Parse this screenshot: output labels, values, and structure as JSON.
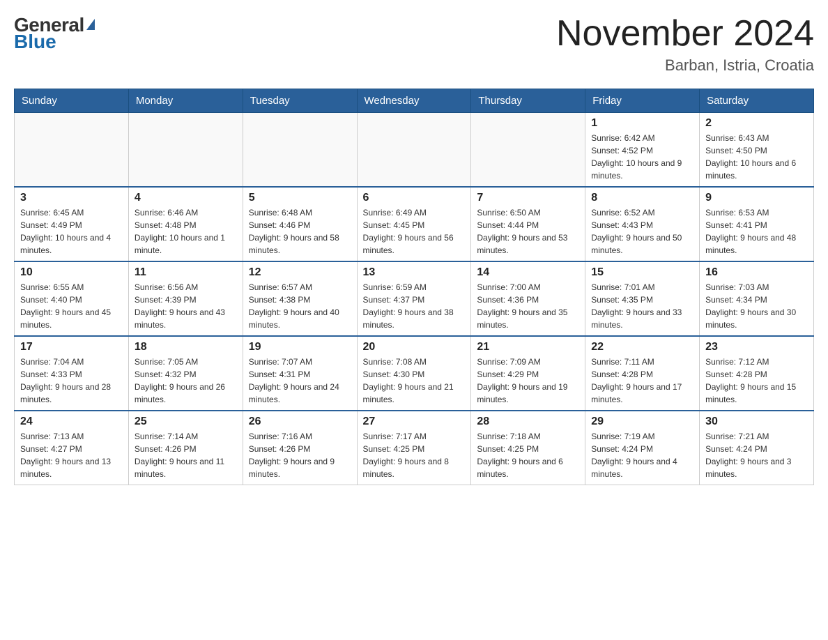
{
  "header": {
    "logo_general": "General",
    "logo_blue": "Blue",
    "month_title": "November 2024",
    "location": "Barban, Istria, Croatia"
  },
  "weekdays": [
    "Sunday",
    "Monday",
    "Tuesday",
    "Wednesday",
    "Thursday",
    "Friday",
    "Saturday"
  ],
  "weeks": [
    [
      {
        "day": "",
        "info": ""
      },
      {
        "day": "",
        "info": ""
      },
      {
        "day": "",
        "info": ""
      },
      {
        "day": "",
        "info": ""
      },
      {
        "day": "",
        "info": ""
      },
      {
        "day": "1",
        "info": "Sunrise: 6:42 AM\nSunset: 4:52 PM\nDaylight: 10 hours and 9 minutes."
      },
      {
        "day": "2",
        "info": "Sunrise: 6:43 AM\nSunset: 4:50 PM\nDaylight: 10 hours and 6 minutes."
      }
    ],
    [
      {
        "day": "3",
        "info": "Sunrise: 6:45 AM\nSunset: 4:49 PM\nDaylight: 10 hours and 4 minutes."
      },
      {
        "day": "4",
        "info": "Sunrise: 6:46 AM\nSunset: 4:48 PM\nDaylight: 10 hours and 1 minute."
      },
      {
        "day": "5",
        "info": "Sunrise: 6:48 AM\nSunset: 4:46 PM\nDaylight: 9 hours and 58 minutes."
      },
      {
        "day": "6",
        "info": "Sunrise: 6:49 AM\nSunset: 4:45 PM\nDaylight: 9 hours and 56 minutes."
      },
      {
        "day": "7",
        "info": "Sunrise: 6:50 AM\nSunset: 4:44 PM\nDaylight: 9 hours and 53 minutes."
      },
      {
        "day": "8",
        "info": "Sunrise: 6:52 AM\nSunset: 4:43 PM\nDaylight: 9 hours and 50 minutes."
      },
      {
        "day": "9",
        "info": "Sunrise: 6:53 AM\nSunset: 4:41 PM\nDaylight: 9 hours and 48 minutes."
      }
    ],
    [
      {
        "day": "10",
        "info": "Sunrise: 6:55 AM\nSunset: 4:40 PM\nDaylight: 9 hours and 45 minutes."
      },
      {
        "day": "11",
        "info": "Sunrise: 6:56 AM\nSunset: 4:39 PM\nDaylight: 9 hours and 43 minutes."
      },
      {
        "day": "12",
        "info": "Sunrise: 6:57 AM\nSunset: 4:38 PM\nDaylight: 9 hours and 40 minutes."
      },
      {
        "day": "13",
        "info": "Sunrise: 6:59 AM\nSunset: 4:37 PM\nDaylight: 9 hours and 38 minutes."
      },
      {
        "day": "14",
        "info": "Sunrise: 7:00 AM\nSunset: 4:36 PM\nDaylight: 9 hours and 35 minutes."
      },
      {
        "day": "15",
        "info": "Sunrise: 7:01 AM\nSunset: 4:35 PM\nDaylight: 9 hours and 33 minutes."
      },
      {
        "day": "16",
        "info": "Sunrise: 7:03 AM\nSunset: 4:34 PM\nDaylight: 9 hours and 30 minutes."
      }
    ],
    [
      {
        "day": "17",
        "info": "Sunrise: 7:04 AM\nSunset: 4:33 PM\nDaylight: 9 hours and 28 minutes."
      },
      {
        "day": "18",
        "info": "Sunrise: 7:05 AM\nSunset: 4:32 PM\nDaylight: 9 hours and 26 minutes."
      },
      {
        "day": "19",
        "info": "Sunrise: 7:07 AM\nSunset: 4:31 PM\nDaylight: 9 hours and 24 minutes."
      },
      {
        "day": "20",
        "info": "Sunrise: 7:08 AM\nSunset: 4:30 PM\nDaylight: 9 hours and 21 minutes."
      },
      {
        "day": "21",
        "info": "Sunrise: 7:09 AM\nSunset: 4:29 PM\nDaylight: 9 hours and 19 minutes."
      },
      {
        "day": "22",
        "info": "Sunrise: 7:11 AM\nSunset: 4:28 PM\nDaylight: 9 hours and 17 minutes."
      },
      {
        "day": "23",
        "info": "Sunrise: 7:12 AM\nSunset: 4:28 PM\nDaylight: 9 hours and 15 minutes."
      }
    ],
    [
      {
        "day": "24",
        "info": "Sunrise: 7:13 AM\nSunset: 4:27 PM\nDaylight: 9 hours and 13 minutes."
      },
      {
        "day": "25",
        "info": "Sunrise: 7:14 AM\nSunset: 4:26 PM\nDaylight: 9 hours and 11 minutes."
      },
      {
        "day": "26",
        "info": "Sunrise: 7:16 AM\nSunset: 4:26 PM\nDaylight: 9 hours and 9 minutes."
      },
      {
        "day": "27",
        "info": "Sunrise: 7:17 AM\nSunset: 4:25 PM\nDaylight: 9 hours and 8 minutes."
      },
      {
        "day": "28",
        "info": "Sunrise: 7:18 AM\nSunset: 4:25 PM\nDaylight: 9 hours and 6 minutes."
      },
      {
        "day": "29",
        "info": "Sunrise: 7:19 AM\nSunset: 4:24 PM\nDaylight: 9 hours and 4 minutes."
      },
      {
        "day": "30",
        "info": "Sunrise: 7:21 AM\nSunset: 4:24 PM\nDaylight: 9 hours and 3 minutes."
      }
    ]
  ]
}
